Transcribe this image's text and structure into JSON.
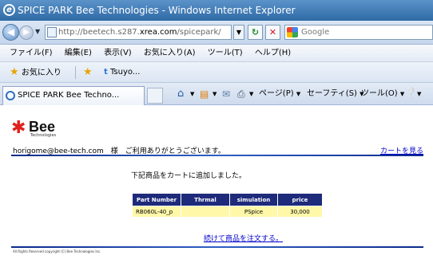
{
  "window": {
    "title": "SPICE PARK Bee Technologies - Windows Internet Explorer"
  },
  "address_bar": {
    "url_prefix": "http://beetech.s287.",
    "url_host": "xrea.com",
    "url_suffix": "/spicepark/",
    "search_placeholder": "Google"
  },
  "menu": {
    "items": [
      "ファイル(F)",
      "編集(E)",
      "表示(V)",
      "お気に入り(A)",
      "ツール(T)",
      "ヘルプ(H)"
    ]
  },
  "favorites": {
    "label": "お気に入り",
    "item": "Tsuyo..."
  },
  "tab": {
    "label": "SPICE PARK Bee Techno..."
  },
  "commands": {
    "page": "ページ(P)",
    "safety": "セーフティ(S)",
    "tools": "ツール(O)"
  },
  "page": {
    "logo_text": "Bee",
    "logo_sub": "Technologies",
    "greeting": "horigome@bee-tech.com　様　ご利用ありがとうございます。",
    "cart_link": "カートを見る",
    "added_message": "下記商品をカートに追加しました。",
    "table": {
      "headers": [
        "Part Number",
        "Thrmal",
        "simulation",
        "price"
      ],
      "rows": [
        [
          "RB060L-40_p",
          "",
          "PSpice",
          "30,000"
        ]
      ]
    },
    "continue_link": "続けて商品を注文する。",
    "copyright": "All Rights Reserved copyright (C) Bee Technologies Inc."
  }
}
